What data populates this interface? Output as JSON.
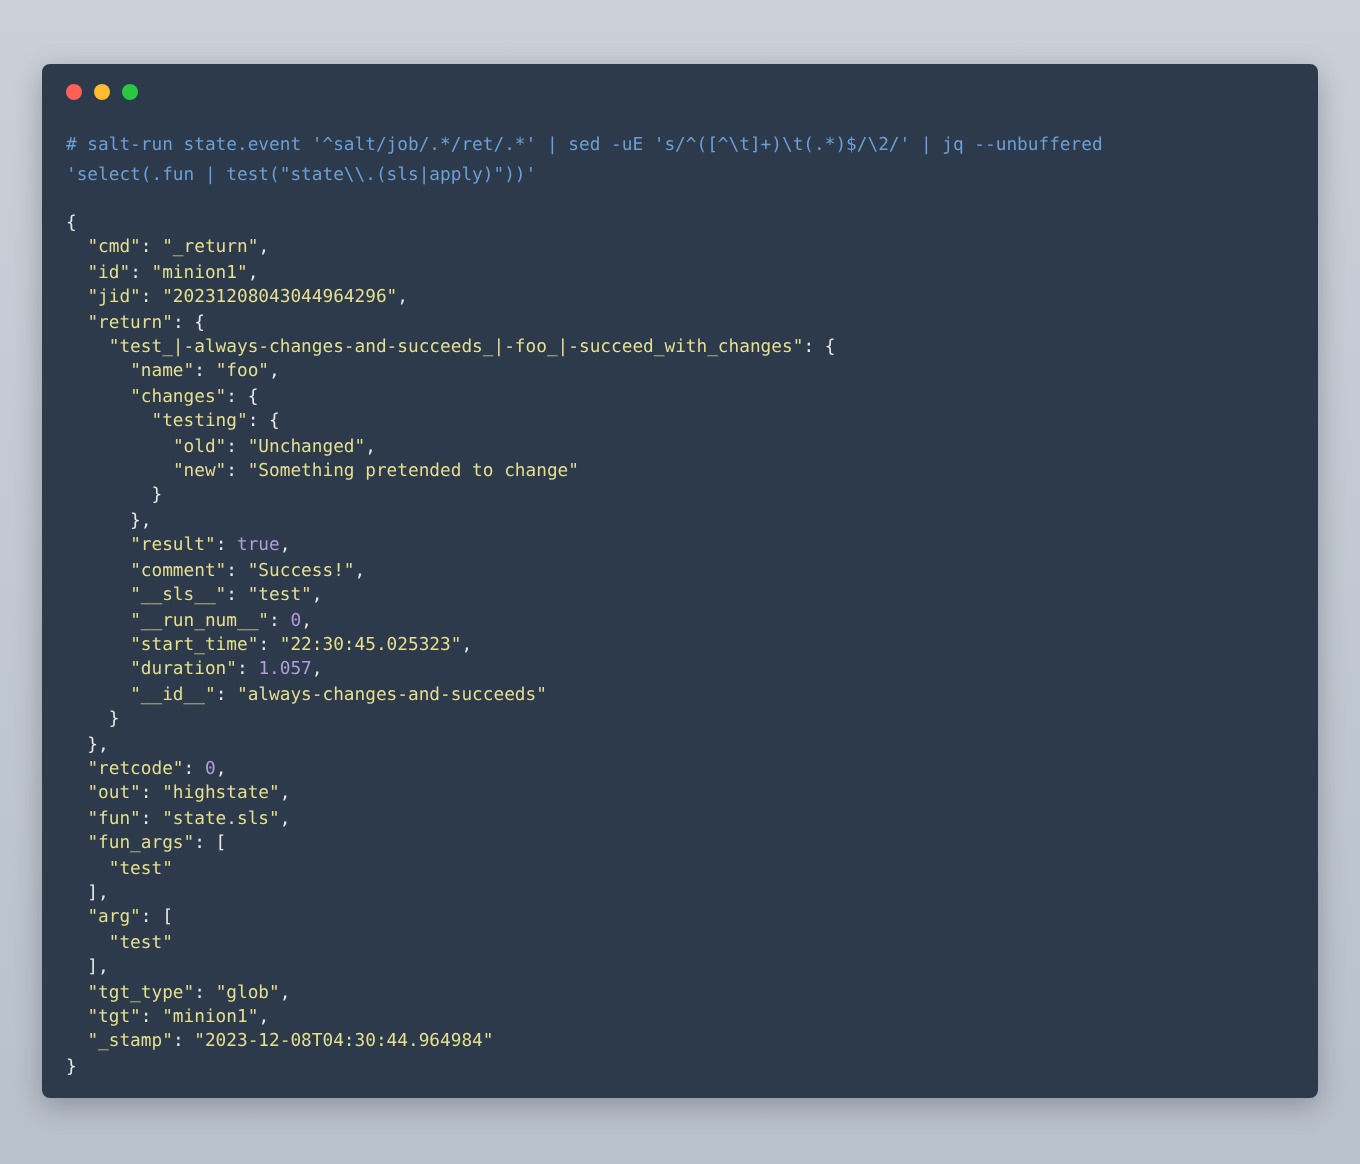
{
  "window": {
    "controls": [
      {
        "kind": "close"
      },
      {
        "kind": "minimize"
      },
      {
        "kind": "zoom"
      }
    ]
  },
  "command": [
    "# salt-run state.event '^salt/job/.*/ret/.*' | sed -uE 's/^([^\\t]+)\\t(.*)$/\\2/' | jq --unbuffered",
    "'select(.fun | test(\"state\\\\.(sls|apply)\"))'"
  ],
  "output": [
    "{",
    "  \"cmd\": \"_return\",",
    "  \"id\": \"minion1\",",
    "  \"jid\": \"20231208043044964296\",",
    "  \"return\": {",
    "    \"test_|-always-changes-and-succeeds_|-foo_|-succeed_with_changes\": {",
    "      \"name\": \"foo\",",
    "      \"changes\": {",
    "        \"testing\": {",
    "          \"old\": \"Unchanged\",",
    "          \"new\": \"Something pretended to change\"",
    "        }",
    "      },",
    "      \"result\": true,",
    "      \"comment\": \"Success!\",",
    "      \"__sls__\": \"test\",",
    "      \"__run_num__\": 0,",
    "      \"start_time\": \"22:30:45.025323\",",
    "      \"duration\": 1.057,",
    "      \"__id__\": \"always-changes-and-succeeds\"",
    "    }",
    "  },",
    "  \"retcode\": 0,",
    "  \"out\": \"highstate\",",
    "  \"fun\": \"state.sls\",",
    "  \"fun_args\": [",
    "    \"test\"",
    "  ],",
    "  \"arg\": [",
    "    \"test\"",
    "  ],",
    "  \"tgt_type\": \"glob\",",
    "  \"tgt\": \"minion1\",",
    "  \"_stamp\": \"2023-12-08T04:30:44.964984\"",
    "}"
  ]
}
